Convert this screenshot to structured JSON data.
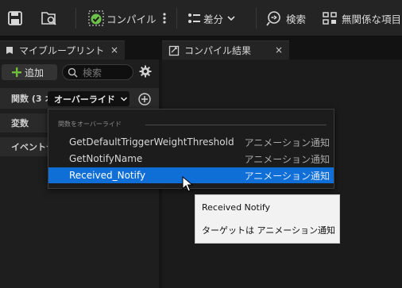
{
  "toolbar": {
    "compile_label": "コンパイル",
    "diff_label": "差分",
    "search_label": "検索",
    "unrelated_label": "無関係な項目"
  },
  "tabs": {
    "my_blueprint": "マイブループリント",
    "compile_results": "コンパイル結果",
    "close_glyph": "×"
  },
  "my_blueprint": {
    "add_label": "追加",
    "search_placeholder": "検索",
    "functions_label": "関数 (3 オ",
    "override_label": "オーバーライド",
    "variables_label": "変数",
    "event_dispatchers_label": "イベントデ"
  },
  "override_menu": {
    "header": "関数をオーバーライド",
    "items": [
      {
        "name": "GetDefaultTriggerWeightThreshold",
        "target": "アニメーション通知"
      },
      {
        "name": "GetNotifyName",
        "target": "アニメーション通知"
      },
      {
        "name": "Received_Notify",
        "target": "アニメーション通知"
      }
    ],
    "selected_index": 2
  },
  "tooltip": {
    "title": "Received Notify",
    "target_line": "ターゲットは アニメーション通知"
  },
  "colors": {
    "selection": "#0f6fd6",
    "add_plus": "#6fbf3a",
    "compile_check": "#6cc24a"
  }
}
